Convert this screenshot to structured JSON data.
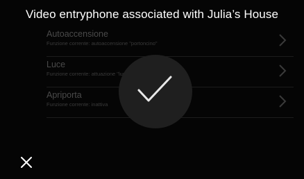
{
  "header": {
    "title": "Video entryphone associated with Julia’s House"
  },
  "settings": {
    "items": [
      {
        "title": "Autoaccensione",
        "subtitle": "Funzione corrente: autoaccensione \"portoncino\""
      },
      {
        "title": "Luce",
        "subtitle": "Funzione corrente: attuazione \"luce portone\""
      },
      {
        "title": "Apriporta",
        "subtitle": "Funzione corrente: inattiva"
      }
    ]
  },
  "overlay": {
    "icon": "checkmark-icon",
    "state": "success"
  },
  "footer": {
    "close_icon": "close-icon"
  },
  "colors": {
    "background": "#050505",
    "title_text": "#ffffff",
    "dimmed_text": "#4a4a4a",
    "overlay_circle": "#1f1f1f",
    "check": "#e8e8e8"
  }
}
